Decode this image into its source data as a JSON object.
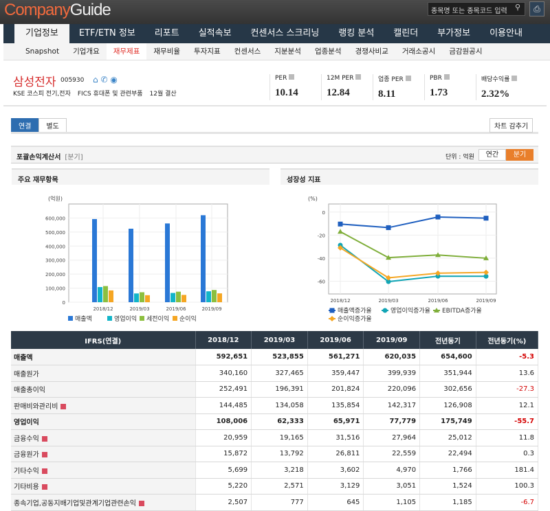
{
  "header": {
    "logo_a": "Company",
    "logo_b": "Guide",
    "search_placeholder": "종목명 또는 종목코드 입력",
    "search_icon": "search-icon",
    "print_icon": "printer-icon"
  },
  "nav": [
    "기업정보",
    "ETF/ETN 정보",
    "리포트",
    "실적속보",
    "컨센서스 스크리닝",
    "랭킹 분석",
    "캘린더",
    "부가정보",
    "이용안내"
  ],
  "subnav": [
    "Snapshot",
    "기업개요",
    "재무제표",
    "재무비율",
    "투자지표",
    "컨센서스",
    "지분분석",
    "업종분석",
    "경쟁사비교",
    "거래소공시",
    "금감원공시"
  ],
  "company": {
    "name": "삼성전자",
    "code": "005930",
    "market": "KSE  코스피 전기,전자",
    "fics": "FICS 휴대폰 및 관련부품",
    "fiscal": "12월 결산"
  },
  "metrics": [
    {
      "label": "PER",
      "value": "10.14"
    },
    {
      "label": "12M PER",
      "value": "12.84"
    },
    {
      "label": "업종 PER",
      "value": "8.11"
    },
    {
      "label": "PBR",
      "value": "1.73"
    },
    {
      "label": "배당수익률",
      "value": "2.32%"
    }
  ],
  "tabs": [
    "연결",
    "별도"
  ],
  "hide_chart": "차트 감추기",
  "section": {
    "title": "포괄손익계산서",
    "period": "[분기]",
    "unit": "단위 : 억원",
    "annual": "연간",
    "quarter": "분기"
  },
  "colors": {
    "accent": "#e97f2b",
    "negative": "#d40000",
    "navy": "#263747"
  },
  "chart_data": [
    {
      "type": "bar",
      "title": "주요 재무항목",
      "ylabel": "(억원)",
      "ylim": [
        0,
        700000
      ],
      "yticks": [
        0,
        100000,
        200000,
        300000,
        400000,
        500000,
        600000
      ],
      "ytick_labels": [
        "0",
        "100,000",
        "200,000",
        "300,000",
        "400,000",
        "500,000",
        "600,000"
      ],
      "grid": true,
      "legend": "bottom",
      "categories": [
        "2018/12",
        "2019/03",
        "2019/06",
        "2019/09"
      ],
      "series": [
        {
          "name": "매출액",
          "color": "#2a78d6",
          "values": [
            592651,
            523855,
            561271,
            620035
          ]
        },
        {
          "name": "영업이익",
          "color": "#12b5c9",
          "values": [
            108006,
            62333,
            65971,
            77779
          ]
        },
        {
          "name": "세전이익",
          "color": "#8cbf3f",
          "values": [
            115000,
            71000,
            75000,
            87000
          ]
        },
        {
          "name": "순이익",
          "color": "#f5a623",
          "values": [
            84000,
            50000,
            52000,
            63000
          ]
        }
      ]
    },
    {
      "type": "line",
      "title": "성장성 지표",
      "ylabel": "(%)",
      "ylim": [
        -71,
        7
      ],
      "yticks": [
        0,
        -20,
        -40,
        -60
      ],
      "ytick_labels": [
        "0",
        "-20",
        "-40",
        "-60"
      ],
      "grid": true,
      "legend": "bottom",
      "categories": [
        "2018/12",
        "2019/03",
        "2019/06",
        "2019/09"
      ],
      "series": [
        {
          "name": "매출액증가율",
          "color": "#1f5fbf",
          "marker": "square",
          "values": [
            -10.4,
            -13.5,
            -4.3,
            -5.3
          ]
        },
        {
          "name": "영업이익증가율",
          "color": "#12a5b5",
          "marker": "circle",
          "values": [
            -28.7,
            -60.3,
            -55.6,
            -55.7
          ]
        },
        {
          "name": "EBITDA증가율",
          "color": "#7fae3a",
          "marker": "triangle",
          "values": [
            -17.0,
            -39.5,
            -37.2,
            -40.0
          ]
        },
        {
          "name": "순이익증가율",
          "color": "#f5a623",
          "marker": "diamond",
          "values": [
            -31.0,
            -57.0,
            -53.0,
            -52.3
          ]
        }
      ]
    }
  ],
  "table": {
    "headers": [
      "IFRS(연결)",
      "2018/12",
      "2019/03",
      "2019/06",
      "2019/09",
      "전년동기",
      "전년동기(%)"
    ],
    "rows": [
      {
        "label": "매출액",
        "bold": true,
        "expand": false,
        "cells": [
          "592,651",
          "523,855",
          "561,271",
          "620,035",
          "654,600",
          "-5.3"
        ]
      },
      {
        "label": "매출원가",
        "bold": false,
        "expand": false,
        "cells": [
          "340,160",
          "327,465",
          "359,447",
          "399,939",
          "351,944",
          "13.6"
        ]
      },
      {
        "label": "매출총이익",
        "bold": false,
        "expand": false,
        "cells": [
          "252,491",
          "196,391",
          "201,824",
          "220,096",
          "302,656",
          "-27.3"
        ]
      },
      {
        "label": "판매비와관리비",
        "bold": false,
        "expand": true,
        "cells": [
          "144,485",
          "134,058",
          "135,854",
          "142,317",
          "126,908",
          "12.1"
        ]
      },
      {
        "label": "영업이익",
        "bold": true,
        "expand": false,
        "cells": [
          "108,006",
          "62,333",
          "65,971",
          "77,779",
          "175,749",
          "-55.7"
        ]
      },
      {
        "label": "금융수익",
        "bold": false,
        "expand": true,
        "cells": [
          "20,959",
          "19,165",
          "31,516",
          "27,964",
          "25,012",
          "11.8"
        ]
      },
      {
        "label": "금융원가",
        "bold": false,
        "expand": true,
        "cells": [
          "15,872",
          "13,792",
          "26,811",
          "22,559",
          "22,494",
          "0.3"
        ]
      },
      {
        "label": "기타수익",
        "bold": false,
        "expand": true,
        "cells": [
          "5,699",
          "3,218",
          "3,602",
          "4,970",
          "1,766",
          "181.4"
        ]
      },
      {
        "label": "기타비용",
        "bold": false,
        "expand": true,
        "cells": [
          "5,220",
          "2,571",
          "3,129",
          "3,051",
          "1,524",
          "100.3"
        ]
      },
      {
        "label": "종속기업,공동지배기업및관계기업관련손익",
        "bold": false,
        "expand": true,
        "cells": [
          "2,507",
          "777",
          "645",
          "1,105",
          "1,185",
          "-6.7"
        ]
      }
    ]
  }
}
